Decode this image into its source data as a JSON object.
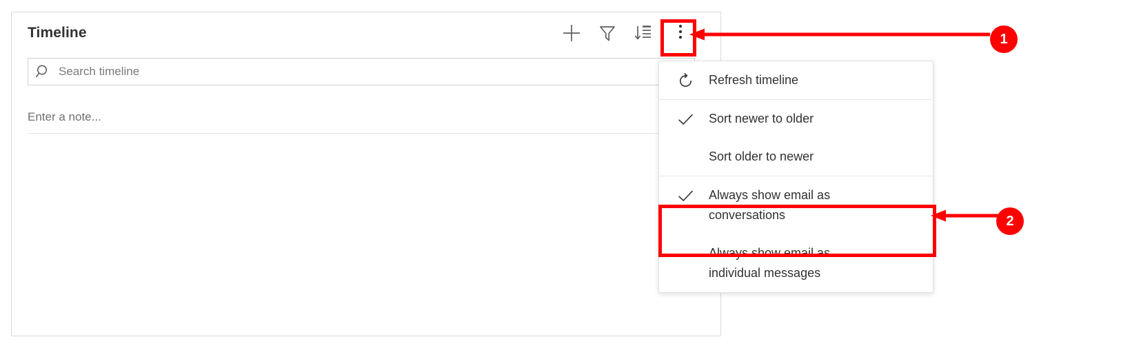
{
  "panel": {
    "title": "Timeline",
    "actions": [
      {
        "name": "add-timeline-record-button",
        "icon": "plus-icon",
        "label": "Add"
      },
      {
        "name": "filter-button",
        "icon": "filter-funnel-icon",
        "label": "Filter"
      },
      {
        "name": "sort-button",
        "icon": "sort-descending-icon",
        "label": "Sort"
      },
      {
        "name": "more-commands-button",
        "icon": "ellipsis-vertical-icon",
        "label": "More commands"
      }
    ]
  },
  "search": {
    "placeholder": "Search timeline",
    "value": "",
    "icon": "search-icon"
  },
  "note": {
    "placeholder": "Enter a note..."
  },
  "context_menu": {
    "items": [
      {
        "label": "Refresh timeline",
        "icon": "refresh-icon",
        "checked": false
      },
      {
        "label": "Sort newer to older",
        "icon": "checkmark-icon",
        "checked": true
      },
      {
        "label": "Sort older to newer",
        "icon": "",
        "checked": false
      },
      {
        "label": "Always show email as conversations",
        "icon": "checkmark-icon",
        "checked": true
      },
      {
        "label": "Always show email as individual messages",
        "icon": "",
        "checked": false
      }
    ]
  },
  "annotations": {
    "accent_color": "#ff0000",
    "badges": [
      {
        "number": "1",
        "target": "more-commands-button"
      },
      {
        "number": "2",
        "target": "always-show-email-as-conversations-menu-item"
      }
    ]
  }
}
